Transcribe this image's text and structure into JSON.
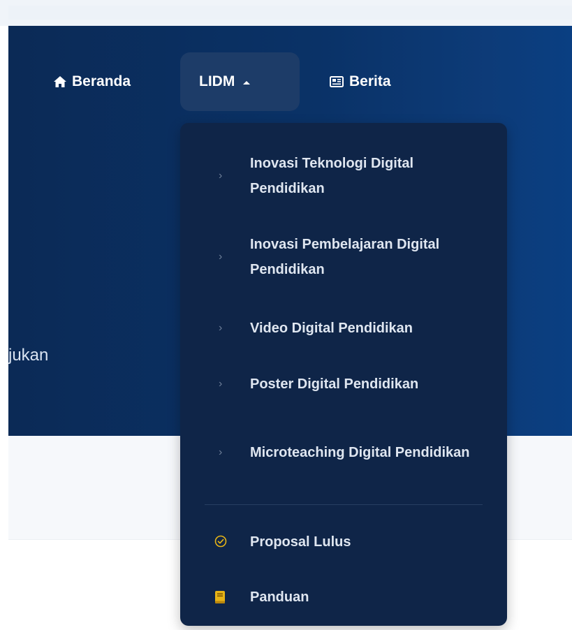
{
  "hero": {
    "partial_text": "jukan"
  },
  "nav": {
    "items": [
      {
        "label": "Beranda",
        "icon": "home-icon"
      },
      {
        "label": "LIDM",
        "icon": "chevron-up-icon",
        "active": true
      },
      {
        "label": "Berita",
        "icon": "newspaper-icon"
      }
    ]
  },
  "dropdown": {
    "categories": [
      {
        "label": "Inovasi Teknologi Digital Pendidikan"
      },
      {
        "label": "Inovasi Pembelajaran Digital Pendidikan"
      },
      {
        "label": "Video Digital Pendidikan"
      },
      {
        "label": "Poster Digital Pendidikan"
      },
      {
        "label": "Microteaching Digital Pendidikan"
      }
    ],
    "links": [
      {
        "label": "Proposal Lulus",
        "icon": "check-circle-icon"
      },
      {
        "label": "Panduan",
        "icon": "book-icon"
      }
    ]
  },
  "colors": {
    "hero_bg": "#0a3267",
    "dropdown_bg": "#0f2548",
    "nav_active_bg": "#1d3c68",
    "accent_yellow": "#e7b416"
  }
}
